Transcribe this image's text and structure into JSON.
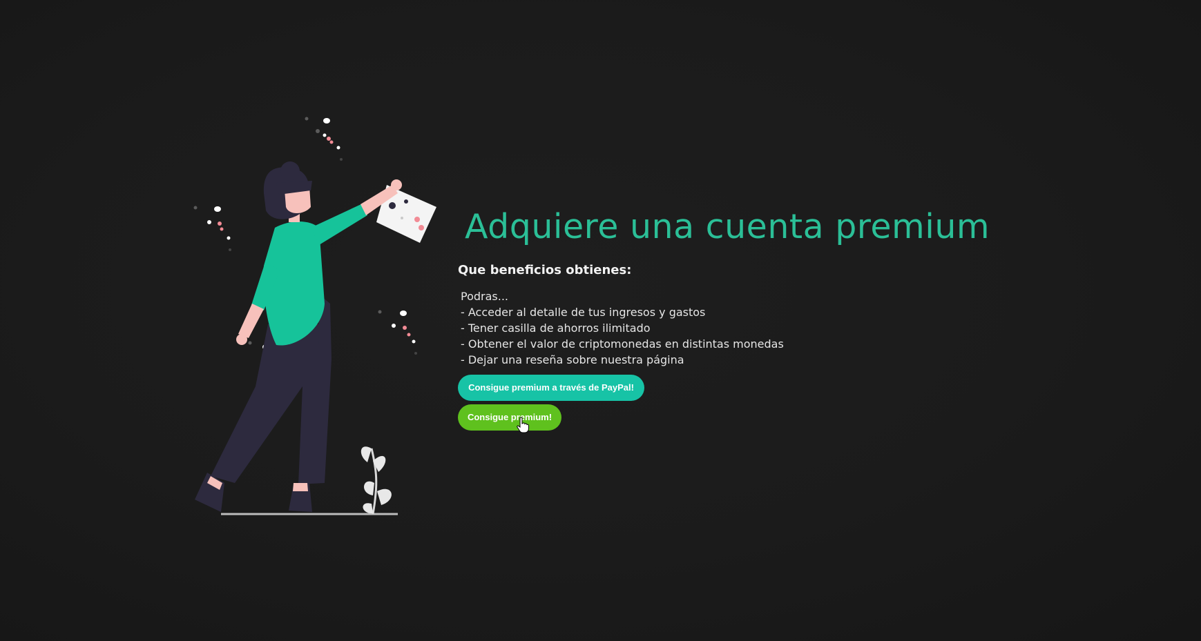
{
  "page": {
    "title": "Adquiere una cuenta premium",
    "subtitle": "Que beneficios obtienes:",
    "benefits": [
      "Podras...",
      "- Acceder al detalle de tus ingresos y gastos",
      "- Tener casilla de ahorros ilimitado",
      "- Obtener el valor de criptomonedas en distintas monedas",
      "- Dejar una reseña sobre nuestra página"
    ],
    "buttons": {
      "paypal_label": "Consigue premium a través de PayPal!",
      "premium_label": "Consigue premium!"
    }
  },
  "illustration": {
    "icon": "woman-holding-paper-illustration"
  },
  "cursor": {
    "icon": "hand-pointer-cursor-icon"
  },
  "colors": {
    "background": "#1b1b1b",
    "title": "#2bbf97",
    "text": "#e6e6e6",
    "paypal_button": "#17c3a6",
    "premium_button": "#5fc11e",
    "shirt": "#16c39a",
    "pants": "#2d2a3e",
    "accent_pink": "#f28b95"
  }
}
